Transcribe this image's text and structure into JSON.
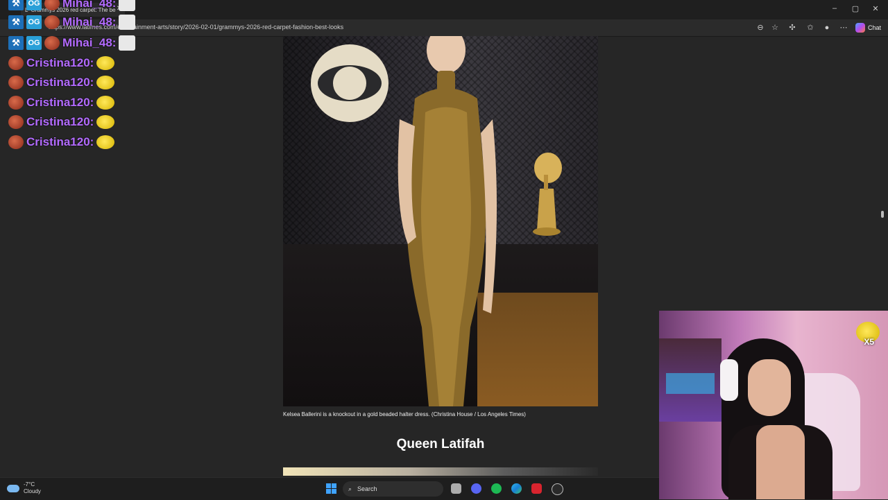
{
  "browser": {
    "tab_title": "Grammys 2026 red carpet: The be",
    "tab_prefix": "L",
    "url": "https://www.latimes.com/entertainment-arts/story/2026-02-01/grammys-2026-red-carpet-fashion-best-looks",
    "chat_label": "Chat"
  },
  "article": {
    "caption": "Kelsea Ballerini is a knockout in a gold beaded halter dress.  (Christina House / Los Angeles Times)",
    "heading": "Queen Latifah"
  },
  "chat_overlay": {
    "messages": [
      {
        "user": "Mihai_48:",
        "badges": [
          "mod-icon",
          "og-badge",
          "cookie-badge"
        ],
        "emote": "cat-emote"
      },
      {
        "user": "Mihai_48:",
        "badges": [
          "mod-icon",
          "og-badge",
          "cookie-badge"
        ],
        "emote": "cat-emote"
      },
      {
        "user": "Mihai_48:",
        "badges": [
          "mod-icon",
          "og-badge",
          "cookie-badge"
        ],
        "emote": "cat-emote"
      },
      {
        "user": "Cristina120:",
        "badges": [
          "cookie-badge"
        ],
        "emote": "yellow-emote"
      },
      {
        "user": "Cristina120:",
        "badges": [
          "cookie-badge"
        ],
        "emote": "yellow-emote"
      },
      {
        "user": "Cristina120:",
        "badges": [
          "cookie-badge"
        ],
        "emote": "yellow-emote"
      },
      {
        "user": "Cristina120:",
        "badges": [
          "cookie-badge"
        ],
        "emote": "yellow-emote"
      },
      {
        "user": "Cristina120:",
        "badges": [
          "cookie-badge"
        ],
        "emote": "yellow-emote"
      }
    ],
    "badge_text": {
      "mod": "⚒",
      "og": "OG"
    }
  },
  "webcam": {
    "emote_count": "X5"
  },
  "taskbar": {
    "weather_temp": "-7°C",
    "weather_desc": "Cloudy",
    "search_label": "Search",
    "icons": [
      "windows-start-icon",
      "task-view-icon",
      "discord-icon",
      "spotify-icon",
      "edge-icon",
      "app-red-icon",
      "steam-icon"
    ]
  },
  "colors": {
    "username": "#b36bff",
    "page_bg": "#262626"
  }
}
